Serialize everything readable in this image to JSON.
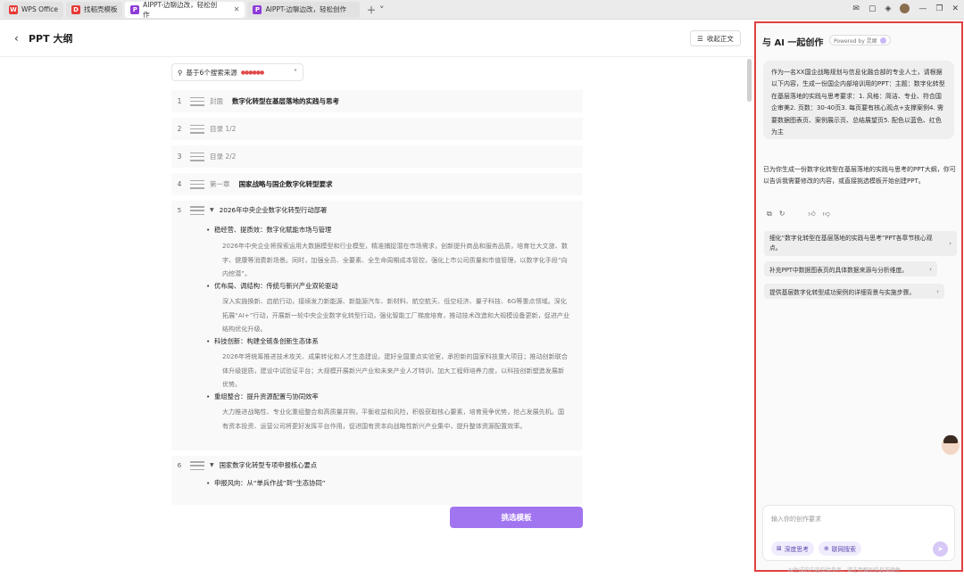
{
  "tabs": [
    {
      "label": "WPS Office",
      "icon": "wps-logo-icon",
      "color": "#e53935"
    },
    {
      "label": "找稻壳模板",
      "icon": "docer-logo-icon",
      "color": "#e53935"
    },
    {
      "label": "AIPPT-边聊边改，轻松创作",
      "icon": "aippt-logo-icon",
      "color": "#8e3bd8",
      "active": true
    },
    {
      "label": "AIPPT-边聊边改，轻松创作",
      "icon": "aippt-logo-icon",
      "color": "#8e3bd8"
    }
  ],
  "header": {
    "title": "PPT 大纲",
    "collapse_label": "收起正文"
  },
  "source": {
    "label": "基于6个搜索来源"
  },
  "outline": [
    {
      "num": "1",
      "kind": "封面",
      "title": "数字化转型在基层落地的实践与思考"
    },
    {
      "num": "2",
      "kind": "目录 1/2",
      "title": ""
    },
    {
      "num": "3",
      "kind": "目录 2/2",
      "title": ""
    },
    {
      "num": "4",
      "kind": "第一章",
      "title": "国家战略与国企数字化转型要求"
    }
  ],
  "section5": {
    "num": "5",
    "heading": "2026年中央企业数字化转型行动部署",
    "points": [
      {
        "title": "稳经营、提质效：数字化赋能市场与管理",
        "body": "2026年中央企业将探索运用大数据模型和行业模型，精准捕捉潜在市场需求，创新提升商品和服务品质，培育壮大文旅、数字、健康等消费新场景。同时，加强全员、全要素、全生命周期成本管控，强化上市公司质量和市值管理，以数字化手段“向内挖潜”。"
      },
      {
        "title": "优布局、调结构：传统与新兴产业双轮驱动",
        "body": "深入实施换新、启航行动，接续发力新能源、新能源汽车、新材料、航空航天、低空经济、量子科技、6G等重点领域。深化拓展“AI+”行动，开展新一轮中央企业数字化转型行动，强化智能工厂梯度培育，推动技术改造和大规模设备更新，促进产业结构优化升级。"
      },
      {
        "title": "科技创新：构建全链条创新生态体系",
        "body": "2026年将统筹推进技术攻关、成果转化和人才生态建设。建好全国重点实验室，承担新的国家科技重大项目；推动创新联合体升级提质，建设中试验证平台；大规模开展新兴产业和未来产业人才特训，加大工程师培养力度，以科技创新塑造发展新优势。"
      },
      {
        "title": "重组整合：提升资源配置与协同效率",
        "body": "大力推进战略性、专业化重组整合和高质量并购，平衡收益和风险，积极获取核心要素，培育竞争优势，抢占发展先机。国有资本投资、运营公司将更好发挥平台作用，促进国有资本向战略性新兴产业集中，提升整体资源配置效率。"
      }
    ]
  },
  "section6": {
    "num": "6",
    "heading": "国家数字化转型专项申报核心要点",
    "points": [
      {
        "title": "申报风向：从“单兵作战”到“生态协同”"
      }
    ]
  },
  "primary_button": "挑选模板",
  "chat": {
    "title": "与 AI 一起创作",
    "powered": "Powered by 灵犀",
    "user_message": "作为一名XX国企战略规划与信息化融合部的专业人士，请根据以下内容，生成一份国企内部培训用的PPT：主题：数字化转型在基层落地的实践与思考要求：1. 风格：简洁、专业、符合国企审美2. 页数：30-40页3. 每页要有核心观点+支撑案例4. 需要数据图表页、案例展示页、总结展望页5. 配色以蓝色、红色为主",
    "ai_message": "已为你生成一份数字化转型在基层落地的实践与思考的PPT大纲，你可以告诉我需要修改的内容，或直接挑选模板开始创建PPT。",
    "suggestions": [
      "细化“数字化转型在基层落地的实践与思考”PPT各章节核心观点。",
      "补充PPT中数据图表页的具体数据来源与分析维度。",
      "提供基层数字化转型成功案例的详细背景与实施步骤。"
    ],
    "input_placeholder": "输入你的创作要求",
    "chip_deep": "深度思考",
    "chip_web": "联网搜索",
    "footer": "AI生成的内容仅供参考，请注意甄别信息准确性"
  }
}
